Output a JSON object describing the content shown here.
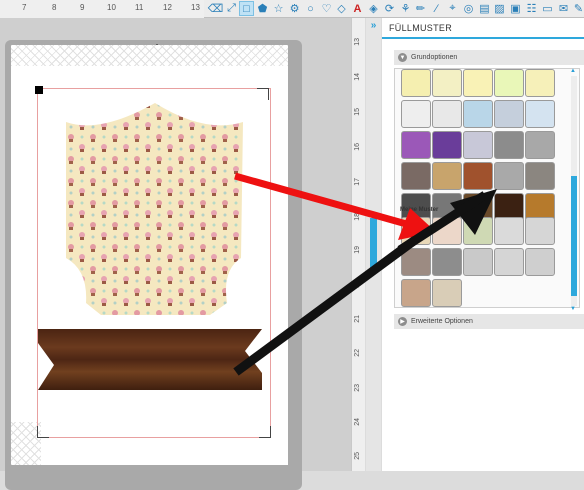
{
  "ruler_top": {
    "labels": [
      "7",
      "8",
      "9",
      "10",
      "11",
      "12",
      "13"
    ]
  },
  "toolbar": {
    "icons": [
      "eraser-icon",
      "move-icon",
      "rectangle-icon",
      "pentagon-icon",
      "star-icon",
      "gear-shape-icon",
      "bubble-icon",
      "heart-icon",
      "text-icon",
      "node-icon",
      "rotate-icon",
      "knife-icon",
      "pen-icon",
      "line-icon",
      "polyline-icon",
      "registration-icon",
      "trace-icon",
      "mirror-icon",
      "fill-icon",
      "offset-icon",
      "layers-icon",
      "library-icon",
      "send-icon",
      "eyedropper-icon",
      "more-icon"
    ]
  },
  "mat": {
    "arrow_icon": "up-arrow-icon"
  },
  "ruler_v": {
    "labels": [
      "13",
      "14",
      "15",
      "16",
      "17",
      "18",
      "19",
      "20",
      "21",
      "22",
      "23",
      "24",
      "25"
    ]
  },
  "panel": {
    "title": "FÜLLMUSTER",
    "collapse_icon": "double-chevron-icon",
    "section_basic": "Grundoptionen",
    "section_advanced": "Erweiterte Optionen",
    "my_patterns_label": "Meine Muster"
  },
  "swatches": {
    "basic_colors": [
      "#f5efb0",
      "#f3f0c4",
      "#f9f2b6",
      "#e9f7b8",
      "#f6f0b9",
      "#eeeeee",
      "#e8e8e8",
      "#b9d6e8",
      "#c5cfdc",
      "#d4e3f0",
      "#9b58b8",
      "#6a3d9a",
      "#c8c8d8",
      "#8c8c8c",
      "#a8a8a8",
      "#7a6a64",
      "#c8a46c",
      "#a0522d",
      "#a9a9a9",
      "#8b8680",
      "#4d4d4d",
      "#777777",
      "#6a4a2a",
      "#3b2112",
      "#b67a2c"
    ],
    "mine_colors": [
      "#e8d8b8",
      "#ecd7c9",
      "#cfd9b4",
      "#dadada",
      "#d6d6d6",
      "#9c8b82",
      "#8d8d8d",
      "#c9c9c9",
      "#d5d5d5",
      "#cfcfcf",
      "#c8a58a",
      "#d9cdb7"
    ]
  },
  "colors": {
    "accent": "#2ea8dc",
    "wood": "#5a2f18",
    "pattern_bg": "#f5e8c0"
  }
}
